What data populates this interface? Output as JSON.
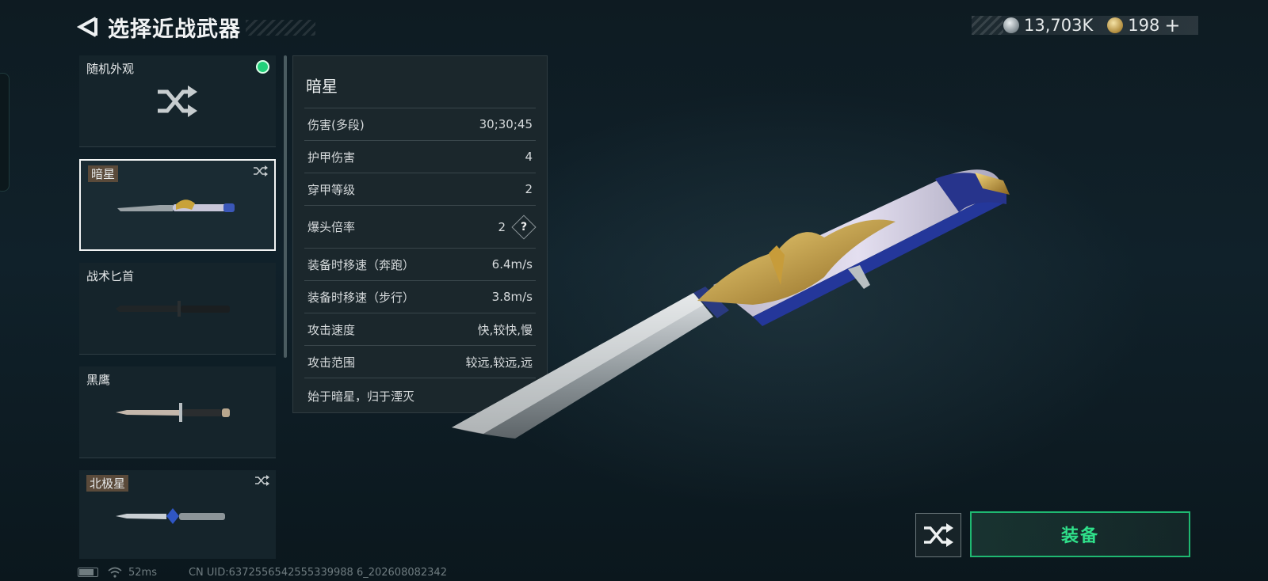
{
  "header": {
    "title": "选择近战武器"
  },
  "currency": {
    "silver": "13,703K",
    "gold": "198"
  },
  "list": [
    {
      "name": "随机外观",
      "selected": false,
      "icon": "shuffle-icon"
    },
    {
      "name": "暗星",
      "selected": true,
      "icon": "knife-anxing"
    },
    {
      "name": "战术匕首",
      "selected": false,
      "icon": "knife-tactical"
    },
    {
      "name": "黑鹰",
      "selected": false,
      "icon": "knife-heiying"
    },
    {
      "name": "北极星",
      "selected": false,
      "icon": "knife-beijixing"
    }
  ],
  "stats": {
    "name": "暗星",
    "rows": [
      {
        "label": "伤害(多段)",
        "value": "30;30;45"
      },
      {
        "label": "护甲伤害",
        "value": "4"
      },
      {
        "label": "穿甲等级",
        "value": "2"
      },
      {
        "label": "爆头倍率",
        "value": "2"
      },
      {
        "label": "装备时移速（奔跑）",
        "value": "6.4m/s"
      },
      {
        "label": "装备时移速（步行）",
        "value": "3.8m/s"
      },
      {
        "label": "攻击速度",
        "value": "快,较快,慢"
      },
      {
        "label": "攻击范围",
        "value": "较远,较远,远"
      }
    ],
    "qmark": "?",
    "description": "始于暗星，归于湮灭"
  },
  "buttons": {
    "equip": "装备"
  },
  "footer": {
    "ping": "52ms",
    "uid": "CN UID:6372556542555339988 6_202608082342"
  },
  "colors": {
    "accent": "#2fe08a",
    "panel": "#1b272c",
    "selected_border": "#f2f4f4"
  }
}
